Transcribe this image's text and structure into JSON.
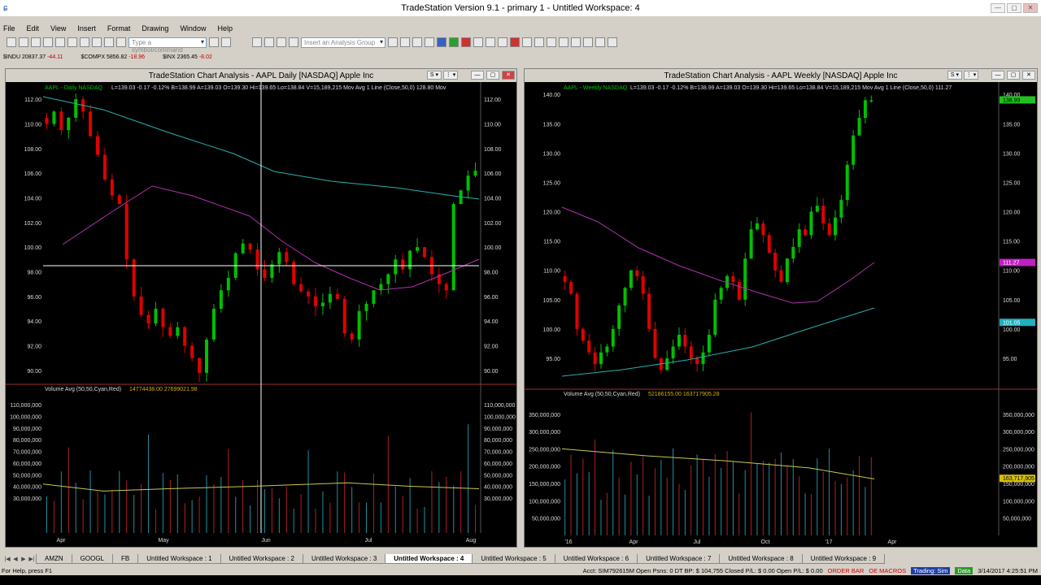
{
  "window": {
    "title": "TradeStation Version 9.1 - primary 1 - Untitled Workspace: 4"
  },
  "menu": [
    "File",
    "Edit",
    "View",
    "Insert",
    "Format",
    "Drawing",
    "Window",
    "Help"
  ],
  "toolbar": {
    "symbol_placeholder": "Type a symbol/command",
    "analysis_group": "Insert an Analysis Group"
  },
  "tickers": [
    {
      "sym": "$INDU 20837.37",
      "chg": "-44.11"
    },
    {
      "sym": "$COMPX 5856.82",
      "chg": "-18.96"
    },
    {
      "sym": "$INX 2365.45",
      "chg": "-8.02"
    }
  ],
  "left_chart": {
    "title": "TradeStation Chart Analysis - AAPL Daily [NASDAQ] Apple Inc",
    "header": "AAPL - Daily  NASDAQ",
    "quote": "L=139.03 -0.17 -0.12%  B=138.99 A=139.03 O=139.30 Hi=139.65 Lo=138.84 V=15,189,215 Mov Avg 1 Line (Close,50,0) 128.80 Mov",
    "y_ticks": [
      "112.00",
      "110.00",
      "108.00",
      "106.00",
      "104.00",
      "102.00",
      "100.00",
      "98.00",
      "96.00",
      "94.00",
      "92.00",
      "90.00"
    ],
    "x_labels": [
      "Apr",
      "May",
      "Jun",
      "Jul",
      "Aug"
    ],
    "volume_label": "Volume Avg (50,50,Cyan,Red)",
    "volume_vals": "14774438.00  27699021.98",
    "vol_ticks": [
      "110,000,000",
      "100,000,000",
      "90,000,000",
      "80,000,000",
      "70,000,000",
      "60,000,000",
      "50,000,000",
      "40,000,000",
      "30,000,000"
    ]
  },
  "right_chart": {
    "title": "TradeStation Chart Analysis - AAPL Weekly [NASDAQ] Apple Inc",
    "header": "AAPL - Weekly  NASDAQ",
    "quote": "L=139.03 -0.17 -0.12%  B=138.99 A=139.03 O=139.30 Hi=139.65 Lo=138.84 V=15,189,215 Mov Avg 1 Line (Close,50,0) 111.27",
    "y_ticks": [
      "140.00",
      "135.00",
      "130.00",
      "125.00",
      "120.00",
      "115.00",
      "110.00",
      "105.00",
      "100.00",
      "95.00"
    ],
    "x_labels": [
      "'16",
      "Apr",
      "Jul",
      "Oct",
      "'17",
      "Apr"
    ],
    "price_tag": "138.99",
    "ma_tag1": "111.27",
    "ma_tag2": "101.05",
    "volume_label": "Volume Avg (50,50,Cyan,Red)",
    "volume_vals": "52186155.00  163717905.28",
    "vol_ticks": [
      "350,000,000",
      "300,000,000",
      "250,000,000",
      "200,000,000",
      "150,000,000",
      "100,000,000",
      "50,000,000"
    ],
    "vol_tag": "163,717,905"
  },
  "tabs": [
    "AMZN",
    "GOOGL",
    "FB",
    "Untitled Workspace : 1",
    "Untitled Workspace : 2",
    "Untitled Workspace : 3",
    "Untitled Workspace : 4",
    "Untitled Workspace : 5",
    "Untitled Workspace : 6",
    "Untitled Workspace : 7",
    "Untitled Workspace : 8",
    "Untitled Workspace : 9"
  ],
  "active_tab": 6,
  "status": {
    "help": "For Help, press F1",
    "account": "Acct: SIM792615M  Open Psns: 0  DT BP: $ 104,755  Closed P/L: $ 0.00  Open P/L: $ 0.00",
    "order_bar": "ORDER BAR",
    "macros": "OE MACROS",
    "trading": "Trading: Sim",
    "data": "Data",
    "datetime": "3/14/2017 4:25:51 PM"
  },
  "colors": {
    "up": "#00c000",
    "down": "#e00000",
    "ma_cyan": "#2ab0b0",
    "ma_magenta": "#b030b0",
    "vol_avg": "#c8c850"
  }
}
